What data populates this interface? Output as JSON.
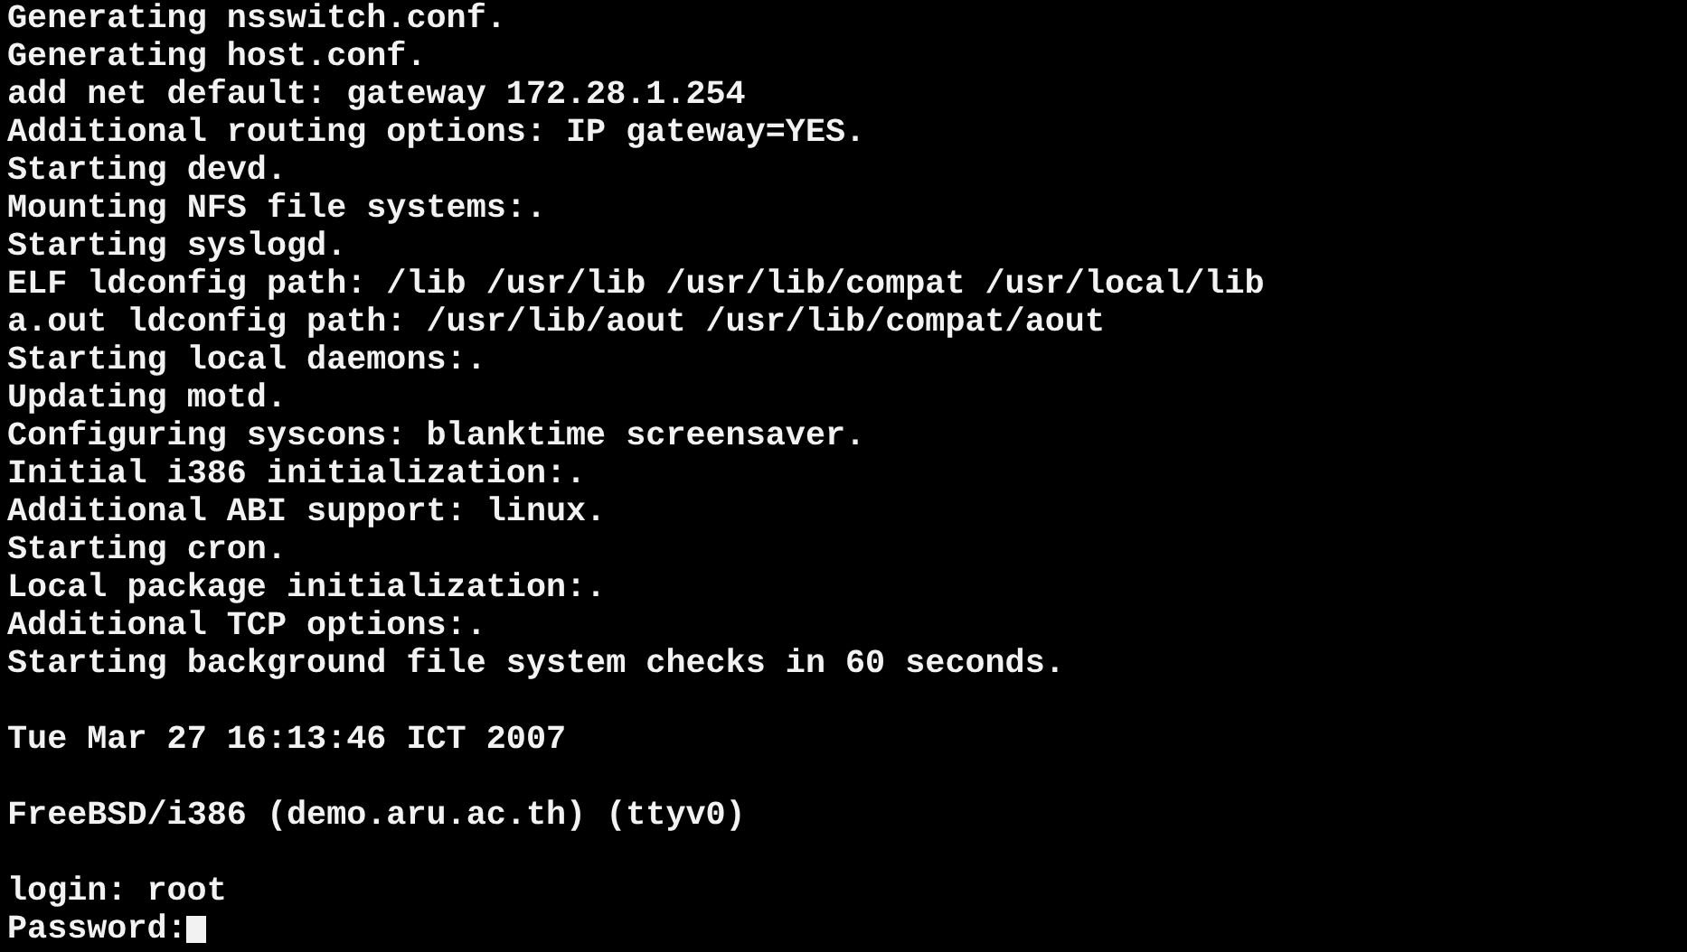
{
  "boot_messages": [
    "Generating nsswitch.conf.",
    "Generating host.conf.",
    "add net default: gateway 172.28.1.254",
    "Additional routing options: IP gateway=YES.",
    "Starting devd.",
    "Mounting NFS file systems:.",
    "Starting syslogd.",
    "ELF ldconfig path: /lib /usr/lib /usr/lib/compat /usr/local/lib",
    "a.out ldconfig path: /usr/lib/aout /usr/lib/compat/aout",
    "Starting local daemons:.",
    "Updating motd.",
    "Configuring syscons: blanktime screensaver.",
    "Initial i386 initialization:.",
    "Additional ABI support: linux.",
    "Starting cron.",
    "Local package initialization:.",
    "Additional TCP options:.",
    "Starting background file system checks in 60 seconds."
  ],
  "date_line": "Tue Mar 27 16:13:46 ICT 2007",
  "banner": "FreeBSD/i386 (demo.aru.ac.th) (ttyv0)",
  "login": {
    "prompt": "login:",
    "value": "root"
  },
  "password": {
    "prompt": "Password:"
  }
}
